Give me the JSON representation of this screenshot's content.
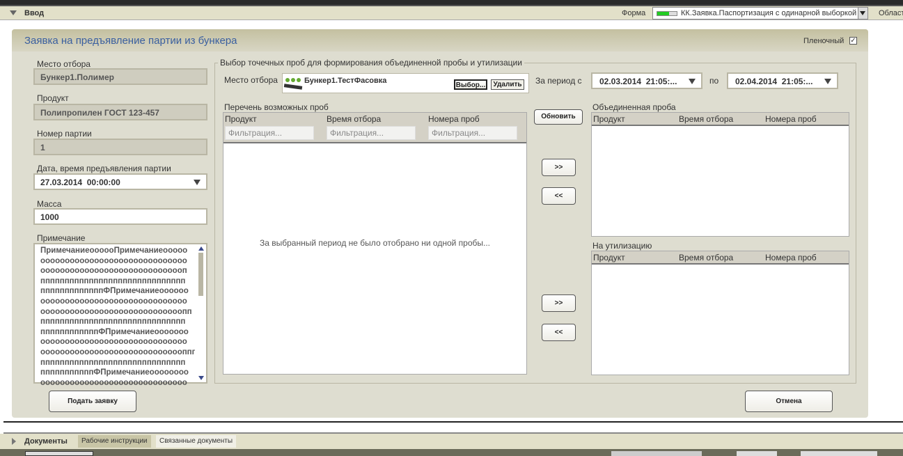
{
  "header": {
    "title": "Ввод",
    "form_label": "Форма",
    "form_value": "КК.Заявка.Паспортизация с одинарной выборкой",
    "area_label": "Област"
  },
  "panel": {
    "title": "Заявка на предъявление партии из бункера",
    "film_label": "Пленочный",
    "film_checked": true
  },
  "left": {
    "place_label": "Место отбора",
    "place_value": "Бункер1.Полимер",
    "product_label": "Продукт",
    "product_value": "Полипропилен ГОСТ 123-457",
    "batch_label": "Номер партии",
    "batch_value": "1",
    "date_label": "Дата, время предъявления партии",
    "date_value": "27.03.2014  00:00:00",
    "mass_label": "Масса",
    "mass_value": "1000",
    "note_label": "Примечание",
    "note_lines": [
      "ПримечаниеоооооПримечаниеооооо",
      "оооооооооооооооооооооооооооооо",
      "оооооооооооооооооооооооооооооп",
      "пппппппппппппппппппппппппппппп",
      "пппппппппппппФПримечаниеоооооо",
      "оооооооооооооооооооооооооооооо",
      "ооооооооооооооооооооооооооооопп",
      "пппппппппппппппппппппппппппппп",
      "ппппппппппппФПримечаниеооооооо",
      "оооооооооооооооооооооооооооооо",
      "оооооооооооооооооооооооооооооппп",
      "пппппппппппппппппппппппппппппп",
      "пппппппппппФПримечаниеоооооооо",
      "оооооооооооооооооооооооооооооо"
    ]
  },
  "selection": {
    "legend": "Выбор точечных проб для формирования объединенной пробы и утилизации",
    "place_label": "Место отбора",
    "place_value": "Бункер1.ТестФасовка",
    "choose_btn": "Выбор...",
    "delete_btn": "Удалить",
    "period_label": "За период с",
    "period_from": "02.03.2014  21:05:...",
    "period_to_label": "по",
    "period_to": "02.04.2014  21:05:...",
    "refresh_btn": "Обновить",
    "list_title": "Перечень возможных проб",
    "columns": [
      "Продукт",
      "Время отбора",
      "Номера проб"
    ],
    "filter_placeholder": "Фильтрация...",
    "empty_text": "За выбранный период не было отобрано ни одной пробы...",
    "move_right": ">>",
    "move_left": "<<",
    "combined_title": "Объединенная проба",
    "disposal_title": "На утилизацию"
  },
  "footer": {
    "submit_btn": "Подать заявку",
    "cancel_btn": "Отмена"
  },
  "bottom": {
    "title": "Документы",
    "tabs": [
      "Рабочие инструкции",
      "Связанные документы"
    ]
  }
}
